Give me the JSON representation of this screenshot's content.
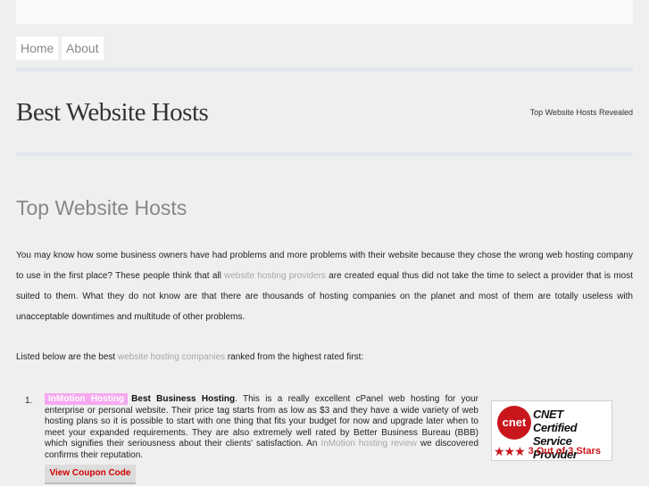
{
  "nav": {
    "home": "Home",
    "about": "About"
  },
  "header": {
    "site_title": "Best Website Hosts",
    "tagline": "Top Website Hosts Revealed"
  },
  "main": {
    "title": "Top Website Hosts",
    "intro_before_link": "You may know how some business owners have had problems and more problems with their website because they chose the wrong web hosting company to use in the first place? These people think that all ",
    "intro_link": "website hosting providers",
    "intro_after_link": " are created equal thus did not take the time to select a provider that is most suited to them. What they do not know are that there are thousands of hosting companies on the planet and most of them are totally useless with unacceptable downtimes and multitude of other problems.",
    "list_intro_before": "Listed below are the best ",
    "list_intro_link": "website hosting companies",
    "list_intro_after": " ranked from the highest rated first:",
    "items": [
      {
        "number": "1.",
        "badge": "InMotion Hosting",
        "lead": "Best Business Hosting",
        "text_before": ". This is a really excellent cPanel web hosting for your enterprise or personal website. Their price tag starts from as low as $3 and they have a wide variety of web hosting plans so it is possible to start with one thing that fits your budget for now and upgrade later when to meet your expanded requirements. They are also extremely well rated by Better Business Bureau (BBB) which signifies their seriousness about their clients' satisfaction. An ",
        "review_link": "InMotion hosting review",
        "text_after": " we discovered confirms their reputation.",
        "coupon": "View  Coupon Code",
        "cnet": {
          "logo": "cnet",
          "line1": "CNET Certified",
          "line2": "Service Provider",
          "rating": "3 Out of 3 Stars",
          "stars": 3,
          "brand_color": "#c9161c"
        }
      }
    ]
  }
}
